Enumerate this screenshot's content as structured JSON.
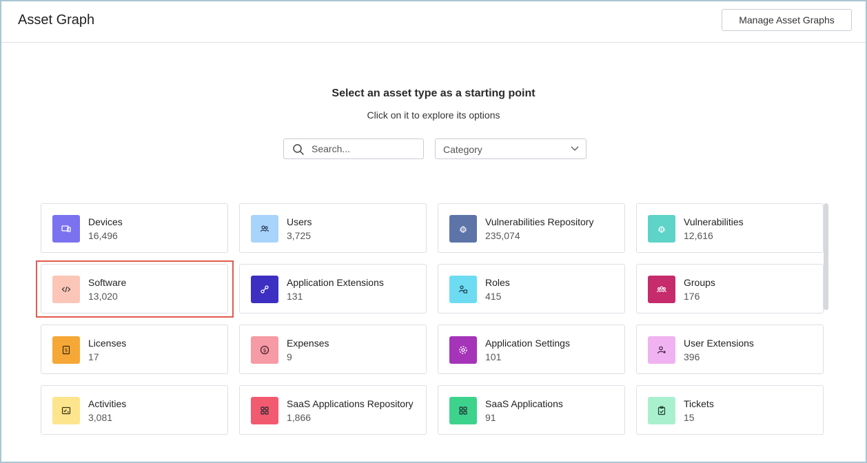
{
  "header": {
    "title": "Asset Graph",
    "manage_label": "Manage Asset Graphs"
  },
  "prompt": {
    "title": "Select an asset type as a starting point",
    "subtitle": "Click on it to explore its options"
  },
  "search": {
    "placeholder": "Search...",
    "value": ""
  },
  "category": {
    "selected": "Category"
  },
  "assets": [
    {
      "name": "Devices",
      "count": "16,496",
      "icon": "devices-icon",
      "color": "#7b72f0"
    },
    {
      "name": "Users",
      "count": "3,725",
      "icon": "users-icon",
      "color": "#a8d3fb"
    },
    {
      "name": "Vulnerabilities Repository",
      "count": "235,074",
      "icon": "bug-icon",
      "color": "#5d74a8"
    },
    {
      "name": "Vulnerabilities",
      "count": "12,616",
      "icon": "bug-icon",
      "color": "#5ed3c8"
    },
    {
      "name": "Software",
      "count": "13,020",
      "icon": "code-icon",
      "color": "#fbc6b8"
    },
    {
      "name": "Application Extensions",
      "count": "131",
      "icon": "plugin-icon",
      "color": "#3c2fc2"
    },
    {
      "name": "Roles",
      "count": "415",
      "icon": "role-icon",
      "color": "#6ddcf2"
    },
    {
      "name": "Groups",
      "count": "176",
      "icon": "groups-icon",
      "color": "#c62b6b"
    },
    {
      "name": "Licenses",
      "count": "17",
      "icon": "license-icon",
      "color": "#f6a837"
    },
    {
      "name": "Expenses",
      "count": "9",
      "icon": "dollar-icon",
      "color": "#f69aa5"
    },
    {
      "name": "Application Settings",
      "count": "101",
      "icon": "gear-icon",
      "color": "#a534b9"
    },
    {
      "name": "User Extensions",
      "count": "396",
      "icon": "user-plus-icon",
      "color": "#f0b2f0"
    },
    {
      "name": "Activities",
      "count": "3,081",
      "icon": "activity-icon",
      "color": "#fde58e"
    },
    {
      "name": "SaaS Applications Repository",
      "count": "1,866",
      "icon": "apps-icon",
      "color": "#f25a70"
    },
    {
      "name": "SaaS Applications",
      "count": "91",
      "icon": "apps-icon",
      "color": "#3ed38c"
    },
    {
      "name": "Tickets",
      "count": "15",
      "icon": "clipboard-icon",
      "color": "#a9f0cf"
    }
  ]
}
